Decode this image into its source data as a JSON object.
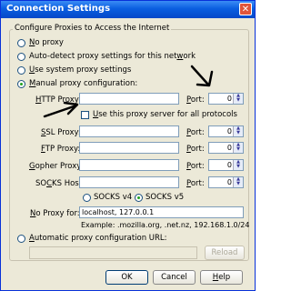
{
  "window": {
    "title": "Connection Settings"
  },
  "group": {
    "legend": "Configure Proxies to Access the Internet"
  },
  "options": {
    "no_proxy": {
      "pre": "",
      "key": "N",
      "post": "o proxy"
    },
    "auto_detect": {
      "pre": "Auto-detect proxy settings for this net",
      "key": "w",
      "post": "ork"
    },
    "system": {
      "pre": "",
      "key": "U",
      "post": "se system proxy settings"
    },
    "manual": {
      "pre": "",
      "key": "M",
      "post": "anual proxy configuration:"
    },
    "auto_config": {
      "pre": "",
      "key": "A",
      "post": "utomatic proxy configuration URL:"
    }
  },
  "proxies": [
    {
      "key": "H",
      "post": "TTP Proxy:",
      "port": "0"
    },
    {
      "key": "S",
      "post": "SL Proxy:",
      "port": "0"
    },
    {
      "key": "F",
      "post": "TP Proxy:",
      "port": "0"
    },
    {
      "key": "G",
      "post": "opher Proxy:",
      "port": "0"
    },
    {
      "key": "C",
      "post": "KS Host:",
      "port": "0"
    }
  ],
  "socks_host_prefix": "SO",
  "port_label": {
    "key": "P",
    "post": "ort:"
  },
  "use_all": {
    "pre": "",
    "key": "U",
    "post": "se this proxy server for all protocols"
  },
  "socks": {
    "v4": "SOCKS v4",
    "v5": "SOCKS v5",
    "selected": "SOCKS v5"
  },
  "no_proxy_for": {
    "key": "N",
    "post": "o Proxy for:",
    "value": "localhost, 127.0.0.1",
    "example": "Example: .mozilla.org, .net.nz, 192.168.1.0/24"
  },
  "buttons": {
    "reload": "Reload",
    "ok": "OK",
    "cancel": "Cancel",
    "help": "Help",
    "help_key": "H",
    "help_post": "elp"
  },
  "selected_mode": "manual",
  "annotations": {
    "arrow_color": "#000000"
  }
}
